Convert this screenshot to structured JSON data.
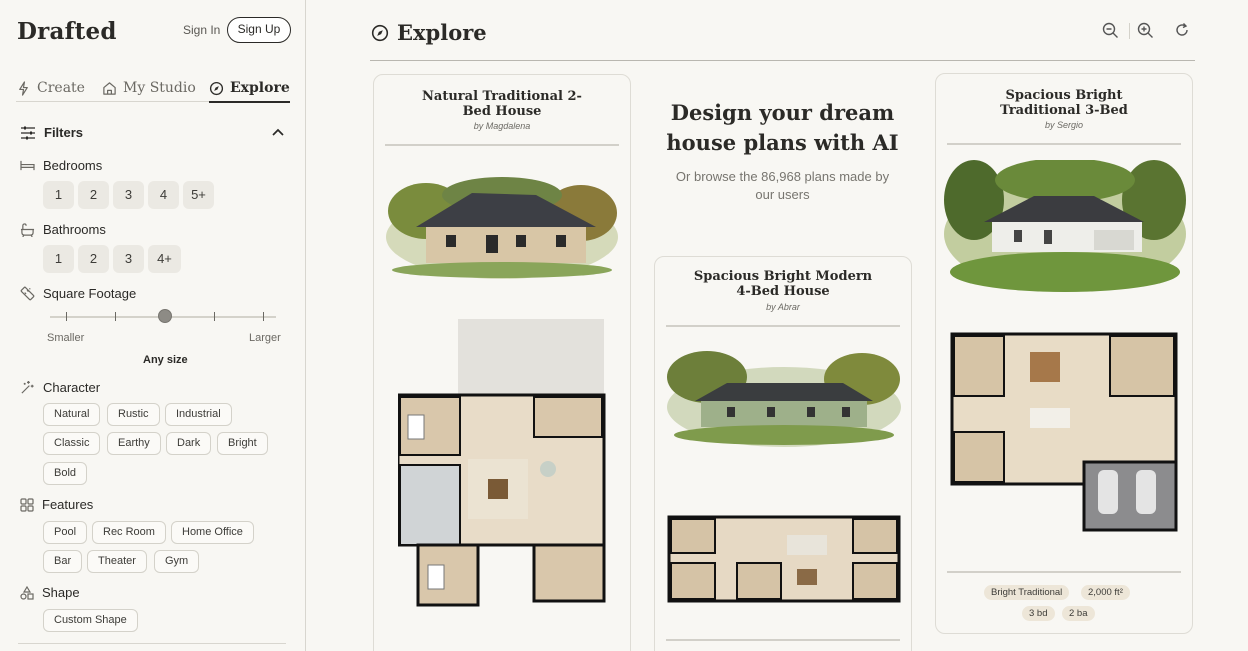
{
  "brand": {
    "logo": "Drafted"
  },
  "auth": {
    "signin": "Sign In",
    "signup": "Sign Up"
  },
  "nav": {
    "create": "Create",
    "studio": "My Studio",
    "explore": "Explore"
  },
  "filters": {
    "title": "Filters",
    "bedrooms": {
      "label": "Bedrooms",
      "options": [
        "1",
        "2",
        "3",
        "4",
        "5+"
      ]
    },
    "bathrooms": {
      "label": "Bathrooms",
      "options": [
        "1",
        "2",
        "3",
        "4+"
      ]
    },
    "sqft": {
      "label": "Square Footage",
      "min_label": "Smaller",
      "max_label": "Larger",
      "value_label": "Any size",
      "position": 0.5
    },
    "character": {
      "label": "Character",
      "options": [
        "Natural",
        "Rustic",
        "Industrial",
        "Classic",
        "Earthy",
        "Dark",
        "Bright",
        "Bold"
      ]
    },
    "features": {
      "label": "Features",
      "options": [
        "Pool",
        "Rec Room",
        "Home Office",
        "Bar",
        "Theater",
        "Gym"
      ]
    },
    "shape": {
      "label": "Shape",
      "options": [
        "Custom Shape"
      ]
    }
  },
  "main": {
    "title": "Explore",
    "promo": {
      "title": "Design your dream house plans with AI",
      "subtitle": "Or browse the 86,968 plans made by our users"
    },
    "cards": [
      {
        "title": "Natural Traditional 2-Bed House",
        "author": "by Magdalena"
      },
      {
        "title": "Spacious Bright Modern 4-Bed House",
        "author": "by Abrar"
      },
      {
        "title": "Spacious Bright Traditional 3-Bed",
        "author": "by Sergio",
        "tags": [
          "Bright Traditional",
          "2,000 ft²",
          "3 bd",
          "2 ba"
        ]
      }
    ]
  },
  "icons": [
    "sparkle-icon",
    "home-icon",
    "compass-icon",
    "filter-sliders-icon",
    "chevron-up-icon",
    "bed-icon",
    "bath-icon",
    "ruler-icon",
    "wand-icon",
    "grid-icon",
    "shapes-icon",
    "zoom-out-icon",
    "zoom-in-icon",
    "refresh-icon"
  ],
  "colors": {
    "text": "#2b2a27",
    "muted": "#6b6963",
    "chip_bg": "#ebe9e3",
    "tag_bg": "#ede6d8",
    "background": "#f8f7f3"
  }
}
